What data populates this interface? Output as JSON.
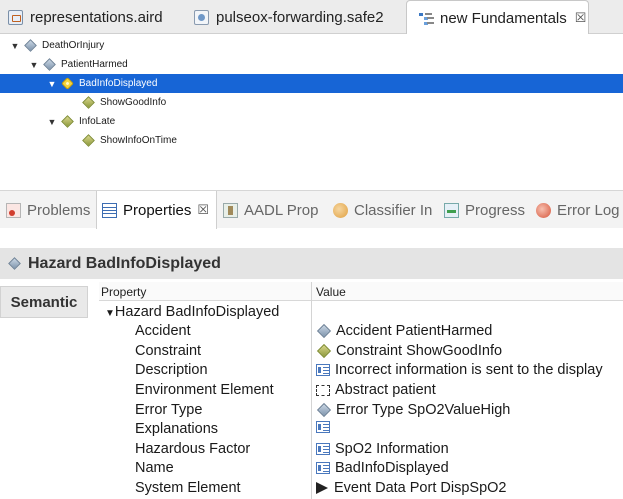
{
  "editor_tabs": [
    {
      "label": "representations.aird",
      "icon": "aird-file-icon"
    },
    {
      "label": "pulseox-forwarding.safe2",
      "icon": "safe2-file-icon"
    },
    {
      "label": "new Fundamentals",
      "icon": "fundamentals-tree-icon",
      "active": true,
      "close": "☒"
    }
  ],
  "tree": [
    {
      "label": "DeathOrInjury",
      "twisty": "▼",
      "icon": "accident-icon"
    },
    {
      "label": "PatientHarmed",
      "twisty": "▼",
      "icon": "accident-icon"
    },
    {
      "label": "BadInfoDisplayed",
      "twisty": "▼",
      "icon": "hazard-icon",
      "selected": true
    },
    {
      "label": "ShowGoodInfo",
      "twisty": "",
      "icon": "constraint-icon"
    },
    {
      "label": "InfoLate",
      "twisty": "▼",
      "icon": "hazard-icon"
    },
    {
      "label": "ShowInfoOnTime",
      "twisty": "",
      "icon": "constraint-icon"
    }
  ],
  "view_tabs": [
    {
      "label": "Problems",
      "icon": "problems-icon"
    },
    {
      "label": "Properties",
      "icon": "properties-icon",
      "active": true,
      "close": "☒"
    },
    {
      "label": "AADL Prop",
      "icon": "aadl-properties-icon"
    },
    {
      "label": "Classifier In",
      "icon": "classifier-icon"
    },
    {
      "label": "Progress",
      "icon": "progress-icon"
    },
    {
      "label": "Error Log",
      "icon": "error-log-icon"
    }
  ],
  "properties": {
    "title": "Hazard BadInfoDisplayed",
    "side_tab": "Semantic",
    "col_property": "Property",
    "col_value": "Value",
    "group_twisty": "▼",
    "group": "Hazard BadInfoDisplayed",
    "rows": [
      {
        "key": "Accident",
        "value": "Accident PatientHarmed",
        "icon": "accident-icon"
      },
      {
        "key": "Constraint",
        "value": "Constraint ShowGoodInfo",
        "icon": "constraint-icon"
      },
      {
        "key": "Description",
        "value": "Incorrect information is sent to the display",
        "icon": "text-icon"
      },
      {
        "key": "Environment Element",
        "value": "Abstract patient",
        "icon": "abstract-icon"
      },
      {
        "key": "Error Type",
        "value": "Error Type SpO2ValueHigh",
        "icon": "error-type-icon"
      },
      {
        "key": "Explanations",
        "value": "",
        "icon": "text-icon"
      },
      {
        "key": "Hazardous Factor",
        "value": "SpO2 Information",
        "icon": "text-icon"
      },
      {
        "key": "Name",
        "value": "BadInfoDisplayed",
        "icon": "text-icon"
      },
      {
        "key": "System Element",
        "value": "Event Data Port DispSpO2",
        "icon": "event-data-port-icon"
      }
    ]
  },
  "colors": {
    "selection": "#1765d6",
    "title_bar": "#e4e4e4"
  }
}
